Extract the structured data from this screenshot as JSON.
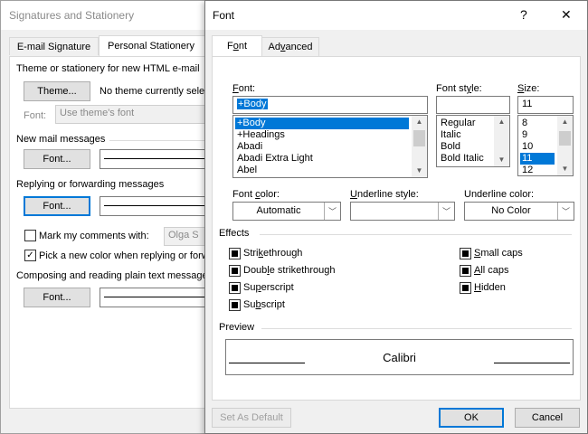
{
  "back_dialog": {
    "title": "Signatures and Stationery",
    "tabs": [
      {
        "label": "E-mail Signature",
        "active": false
      },
      {
        "label": "Personal Stationery",
        "active": true
      }
    ],
    "theme_label": "Theme or stationery for new HTML e-mail",
    "theme_button": "Theme...",
    "no_theme_text": "No theme currently selected",
    "font_label": "Font:",
    "font_select_value": "Use theme's font",
    "new_mail_heading": "New mail messages",
    "font_button": "Font...",
    "replying_heading": "Replying or forwarding messages",
    "mark_comments_label": "Mark my comments with:",
    "mark_comments_value": "Olga S",
    "pick_color_label": "Pick a new color when replying or forwarding",
    "composing_heading": "Composing and reading plain text messages"
  },
  "font_dialog": {
    "title": "Font",
    "help_icon": "?",
    "close_icon": "✕",
    "tabs": [
      {
        "label": "Font",
        "active": true
      },
      {
        "label": "Advanced",
        "active": false
      }
    ],
    "font_label": "Font:",
    "font_value": "+Body",
    "font_list": [
      "+Body",
      "+Headings",
      "Abadi",
      "Abadi Extra Light",
      "Abel"
    ],
    "font_selected_index": 0,
    "style_label": "Font style:",
    "style_value": "",
    "style_list": [
      "Regular",
      "Italic",
      "Bold",
      "Bold Italic"
    ],
    "size_label": "Size:",
    "size_value": "11",
    "size_list": [
      "8",
      "9",
      "10",
      "11",
      "12"
    ],
    "size_selected_index": 3,
    "font_color_label": "Font color:",
    "font_color_value": "Automatic",
    "underline_style_label": "Underline style:",
    "underline_style_value": "",
    "underline_color_label": "Underline color:",
    "underline_color_value": "No Color",
    "effects_heading": "Effects",
    "effects_left": [
      "Strikethrough",
      "Double strikethrough",
      "Superscript",
      "Subscript"
    ],
    "effects_right": [
      "Small caps",
      "All caps",
      "Hidden"
    ],
    "preview_heading": "Preview",
    "preview_text": "Calibri",
    "set_default_button": "Set As Default",
    "ok_button": "OK",
    "cancel_button": "Cancel"
  }
}
